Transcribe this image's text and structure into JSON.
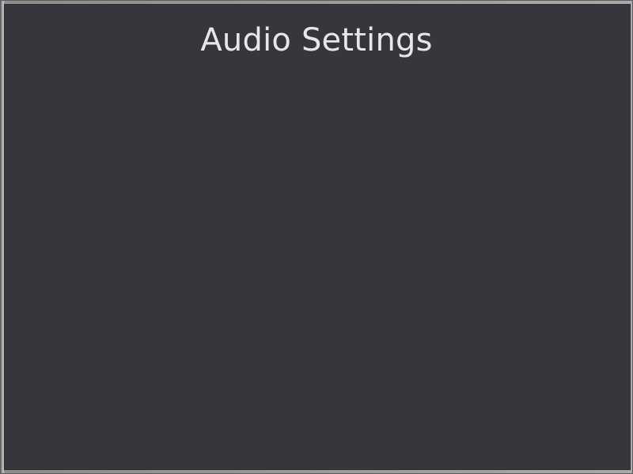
{
  "window": {
    "title": "Audio Settings"
  },
  "colors": {
    "background": "#36373c",
    "title_text": "#e6e7ea",
    "frame": "#8a8a8a"
  }
}
